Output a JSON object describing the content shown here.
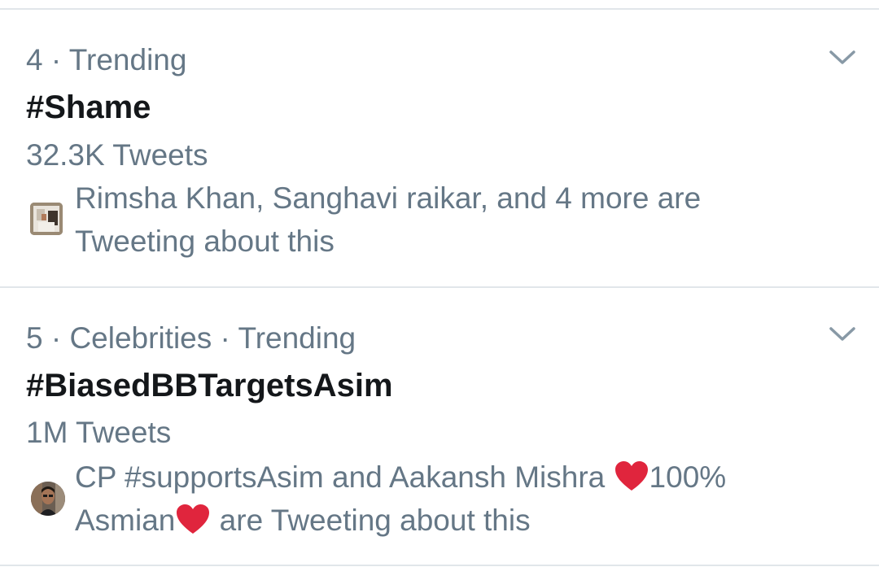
{
  "trends": [
    {
      "meta": "4 · Trending",
      "title": "#Shame",
      "count": "32.3K Tweets",
      "context_line1": "Rimsha Khan, Sanghavi raikar, and 4 more are",
      "context_line2": "Tweeting about this"
    },
    {
      "meta": "5 · Celebrities · Trending",
      "title": "#BiasedBBTargetsAsim",
      "count": "1M Tweets",
      "context_line1_before_heart": "CP #supportsAsim and Aakansh Mishra ",
      "context_line1_after_heart": "100%",
      "context_line2_before_heart": "Asmian",
      "context_line2_after_heart": " are Tweeting about this"
    }
  ],
  "icons": {
    "chevron": "chevron-down-icon",
    "heart": "red-heart-emoji"
  },
  "colors": {
    "primary_text": "#14171a",
    "secondary_text": "#657786",
    "divider": "#e1e6ea",
    "heart": "#e0253d"
  }
}
